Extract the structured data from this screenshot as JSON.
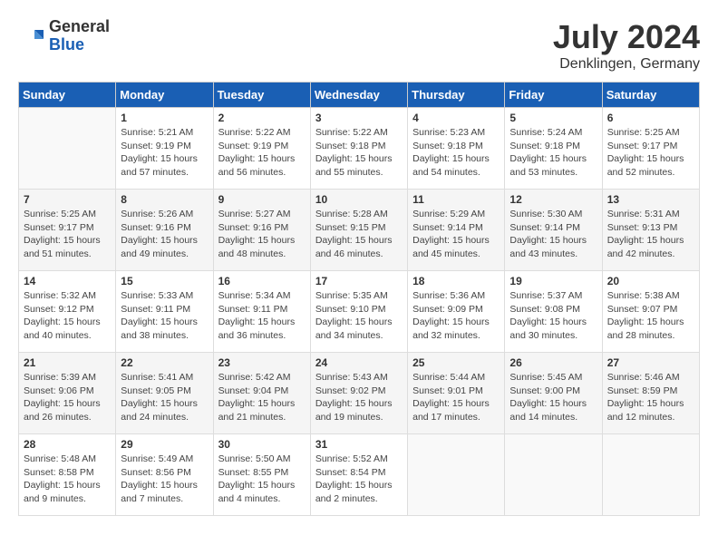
{
  "header": {
    "logo_general": "General",
    "logo_blue": "Blue",
    "title": "July 2024",
    "location": "Denklingen, Germany"
  },
  "weekdays": [
    "Sunday",
    "Monday",
    "Tuesday",
    "Wednesday",
    "Thursday",
    "Friday",
    "Saturday"
  ],
  "weeks": [
    [
      {
        "day": "",
        "info": ""
      },
      {
        "day": "1",
        "info": "Sunrise: 5:21 AM\nSunset: 9:19 PM\nDaylight: 15 hours\nand 57 minutes."
      },
      {
        "day": "2",
        "info": "Sunrise: 5:22 AM\nSunset: 9:19 PM\nDaylight: 15 hours\nand 56 minutes."
      },
      {
        "day": "3",
        "info": "Sunrise: 5:22 AM\nSunset: 9:18 PM\nDaylight: 15 hours\nand 55 minutes."
      },
      {
        "day": "4",
        "info": "Sunrise: 5:23 AM\nSunset: 9:18 PM\nDaylight: 15 hours\nand 54 minutes."
      },
      {
        "day": "5",
        "info": "Sunrise: 5:24 AM\nSunset: 9:18 PM\nDaylight: 15 hours\nand 53 minutes."
      },
      {
        "day": "6",
        "info": "Sunrise: 5:25 AM\nSunset: 9:17 PM\nDaylight: 15 hours\nand 52 minutes."
      }
    ],
    [
      {
        "day": "7",
        "info": "Sunrise: 5:25 AM\nSunset: 9:17 PM\nDaylight: 15 hours\nand 51 minutes."
      },
      {
        "day": "8",
        "info": "Sunrise: 5:26 AM\nSunset: 9:16 PM\nDaylight: 15 hours\nand 49 minutes."
      },
      {
        "day": "9",
        "info": "Sunrise: 5:27 AM\nSunset: 9:16 PM\nDaylight: 15 hours\nand 48 minutes."
      },
      {
        "day": "10",
        "info": "Sunrise: 5:28 AM\nSunset: 9:15 PM\nDaylight: 15 hours\nand 46 minutes."
      },
      {
        "day": "11",
        "info": "Sunrise: 5:29 AM\nSunset: 9:14 PM\nDaylight: 15 hours\nand 45 minutes."
      },
      {
        "day": "12",
        "info": "Sunrise: 5:30 AM\nSunset: 9:14 PM\nDaylight: 15 hours\nand 43 minutes."
      },
      {
        "day": "13",
        "info": "Sunrise: 5:31 AM\nSunset: 9:13 PM\nDaylight: 15 hours\nand 42 minutes."
      }
    ],
    [
      {
        "day": "14",
        "info": "Sunrise: 5:32 AM\nSunset: 9:12 PM\nDaylight: 15 hours\nand 40 minutes."
      },
      {
        "day": "15",
        "info": "Sunrise: 5:33 AM\nSunset: 9:11 PM\nDaylight: 15 hours\nand 38 minutes."
      },
      {
        "day": "16",
        "info": "Sunrise: 5:34 AM\nSunset: 9:11 PM\nDaylight: 15 hours\nand 36 minutes."
      },
      {
        "day": "17",
        "info": "Sunrise: 5:35 AM\nSunset: 9:10 PM\nDaylight: 15 hours\nand 34 minutes."
      },
      {
        "day": "18",
        "info": "Sunrise: 5:36 AM\nSunset: 9:09 PM\nDaylight: 15 hours\nand 32 minutes."
      },
      {
        "day": "19",
        "info": "Sunrise: 5:37 AM\nSunset: 9:08 PM\nDaylight: 15 hours\nand 30 minutes."
      },
      {
        "day": "20",
        "info": "Sunrise: 5:38 AM\nSunset: 9:07 PM\nDaylight: 15 hours\nand 28 minutes."
      }
    ],
    [
      {
        "day": "21",
        "info": "Sunrise: 5:39 AM\nSunset: 9:06 PM\nDaylight: 15 hours\nand 26 minutes."
      },
      {
        "day": "22",
        "info": "Sunrise: 5:41 AM\nSunset: 9:05 PM\nDaylight: 15 hours\nand 24 minutes."
      },
      {
        "day": "23",
        "info": "Sunrise: 5:42 AM\nSunset: 9:04 PM\nDaylight: 15 hours\nand 21 minutes."
      },
      {
        "day": "24",
        "info": "Sunrise: 5:43 AM\nSunset: 9:02 PM\nDaylight: 15 hours\nand 19 minutes."
      },
      {
        "day": "25",
        "info": "Sunrise: 5:44 AM\nSunset: 9:01 PM\nDaylight: 15 hours\nand 17 minutes."
      },
      {
        "day": "26",
        "info": "Sunrise: 5:45 AM\nSunset: 9:00 PM\nDaylight: 15 hours\nand 14 minutes."
      },
      {
        "day": "27",
        "info": "Sunrise: 5:46 AM\nSunset: 8:59 PM\nDaylight: 15 hours\nand 12 minutes."
      }
    ],
    [
      {
        "day": "28",
        "info": "Sunrise: 5:48 AM\nSunset: 8:58 PM\nDaylight: 15 hours\nand 9 minutes."
      },
      {
        "day": "29",
        "info": "Sunrise: 5:49 AM\nSunset: 8:56 PM\nDaylight: 15 hours\nand 7 minutes."
      },
      {
        "day": "30",
        "info": "Sunrise: 5:50 AM\nSunset: 8:55 PM\nDaylight: 15 hours\nand 4 minutes."
      },
      {
        "day": "31",
        "info": "Sunrise: 5:52 AM\nSunset: 8:54 PM\nDaylight: 15 hours\nand 2 minutes."
      },
      {
        "day": "",
        "info": ""
      },
      {
        "day": "",
        "info": ""
      },
      {
        "day": "",
        "info": ""
      }
    ]
  ]
}
